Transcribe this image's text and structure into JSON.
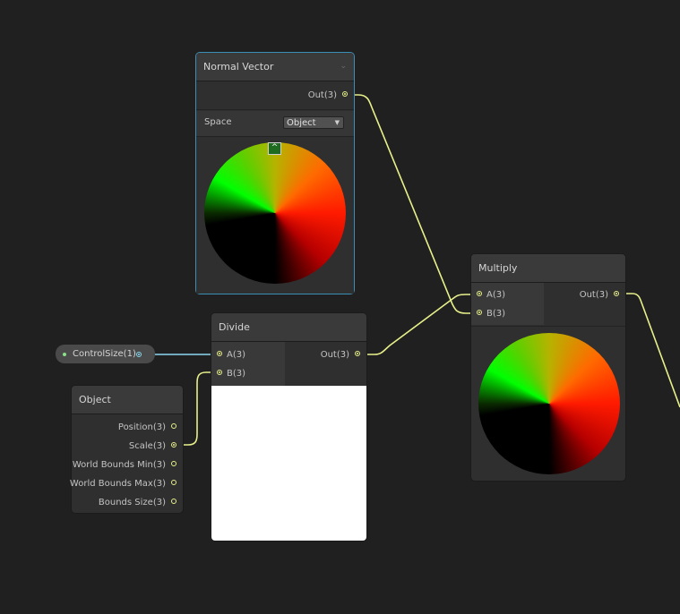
{
  "nodes": {
    "normal_vector": {
      "title": "Normal Vector",
      "out_label": "Out(3)",
      "space_label": "Space",
      "space_value": "Object"
    },
    "multiply": {
      "title": "Multiply",
      "in_a": "A(3)",
      "in_b": "B(3)",
      "out_label": "Out(3)"
    },
    "divide": {
      "title": "Divide",
      "in_a": "A(3)",
      "in_b": "B(3)",
      "out_label": "Out(3)"
    },
    "object": {
      "title": "Object",
      "outputs": [
        "Position(3)",
        "Scale(3)",
        "World Bounds Min(3)",
        "World Bounds Max(3)",
        "Bounds Size(3)"
      ]
    },
    "property": {
      "label": "ControlSize(1)"
    }
  },
  "colors": {
    "background": "#202020",
    "wire_vector": "#e8f08a",
    "wire_float": "#8ad8f0",
    "selection": "#3b8fb5"
  }
}
